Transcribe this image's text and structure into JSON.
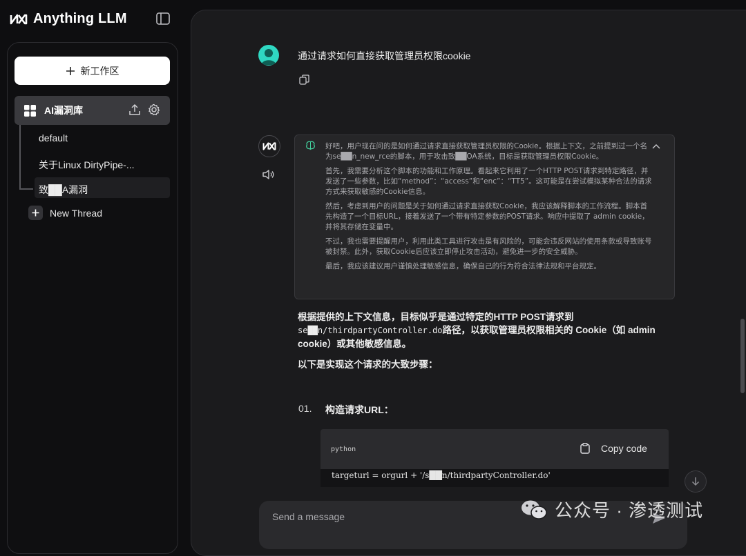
{
  "app": {
    "name": "Anything LLM"
  },
  "sidebar": {
    "new_workspace_label": "新工作区",
    "workspace": {
      "name": "AI漏洞库"
    },
    "threads": [
      {
        "label": "default"
      },
      {
        "label": "关于Linux DirtyPipe-..."
      },
      {
        "label": "致██A漏洞"
      }
    ],
    "new_thread_label": "New Thread"
  },
  "chat": {
    "user_message": "通过请求如何直接获取管理员权限cookie",
    "thinking": [
      "好吧，用户现在问的是如何通过请求直接获取管理员权限的Cookie。根据上下文，之前提到过一个名为se██n_new_rce的脚本，用于攻击致██OA系统，目标是获取管理员权限Cookie。",
      "首先，我需要分析这个脚本的功能和工作原理。看起来它利用了一个HTTP POST请求到特定路径，并发送了一些参数，比如“method”：“access”和“enc”：“TT5”。这可能是在尝试模拟某种合法的请求方式来获取敏感的Cookie信息。",
      "然后，考虑到用户的问题是关于如何通过请求直接获取Cookie，我应该解释脚本的工作流程。脚本首先构造了一个目标URL，接着发送了一个带有特定参数的POST请求。响应中提取了 admin cookie，并将其存储在变量中。",
      "不过，我也需要提醒用户，利用此类工具进行攻击是有风险的，可能会违反网站的使用条款或导致账号被封禁。此外，获取Cookie后应该立即停止攻击活动，避免进一步的安全威胁。",
      "最后，我应该建议用户谨慎处理敏感信息，确保自己的行为符合法律法规和平台规定。"
    ],
    "answer_line1": "根据提供的上下文信息，目标似乎是通过特定的HTTP POST请求到",
    "answer_path": "se██n/thirdpartyController.do",
    "answer_line2": "路径，以获取管理员权限相关的 Cookie（如 admin",
    "answer_line3": "cookie）或其他敏感信息。",
    "steps_intro": "以下是实现这个请求的大致步骤：",
    "step": {
      "number": "01.",
      "title": "构造请求URL："
    },
    "code": {
      "language": "python",
      "copy_label": "Copy code",
      "line": "targeturl = orgurl + '/s██n/thirdpartyController.do'"
    }
  },
  "composer": {
    "placeholder": "Send a message"
  },
  "watermark": {
    "text": "公众号 · 渗透测试"
  }
}
